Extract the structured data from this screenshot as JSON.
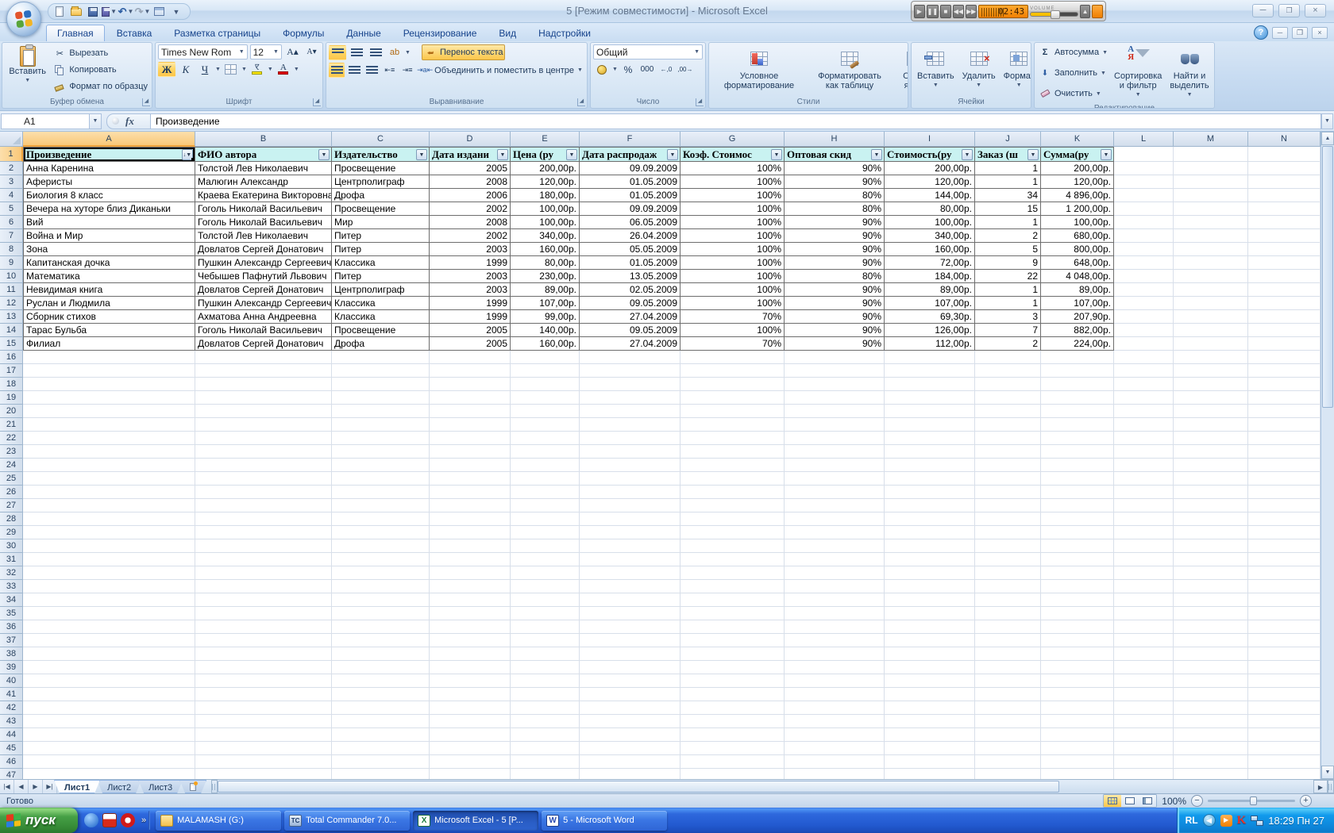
{
  "titlebar": {
    "title": "5  [Режим совместимости] - Microsoft Excel",
    "player": {
      "time": "02:43",
      "volume_label": "VOLUME"
    },
    "qat_icons": [
      "new-document",
      "open-folder",
      "save",
      "save-as",
      "undo",
      "redo",
      "print-preview",
      "customize-qat"
    ]
  },
  "ribbon": {
    "tabs": [
      {
        "label": "Главная",
        "active": true
      },
      {
        "label": "Вставка",
        "active": false
      },
      {
        "label": "Разметка страницы",
        "active": false
      },
      {
        "label": "Формулы",
        "active": false
      },
      {
        "label": "Данные",
        "active": false
      },
      {
        "label": "Рецензирование",
        "active": false
      },
      {
        "label": "Вид",
        "active": false
      },
      {
        "label": "Надстройки",
        "active": false
      }
    ],
    "clipboard": {
      "title": "Буфер обмена",
      "paste": "Вставить",
      "cut": "Вырезать",
      "copy": "Копировать",
      "format_painter": "Формат по образцу"
    },
    "font": {
      "title": "Шрифт",
      "font_name": "Times New Rom",
      "font_size": "12",
      "bold": "Ж",
      "italic": "К",
      "underline": "Ч"
    },
    "alignment": {
      "title": "Выравнивание",
      "wrap_text": "Перенос текста",
      "merge_center": "Объединить и поместить в центре"
    },
    "number": {
      "title": "Число",
      "format": "Общий",
      "percent": "%",
      "thousands": "000"
    },
    "styles": {
      "title": "Стили",
      "conditional": "Условное форматирование",
      "format_table": "Форматировать как таблицу",
      "cell_styles": "Стили ячеек"
    },
    "cells": {
      "title": "Ячейки",
      "insert": "Вставить",
      "delete": "Удалить",
      "format": "Формат"
    },
    "editing": {
      "title": "Редактирование",
      "autosum": "Автосумма",
      "fill": "Заполнить",
      "clear": "Очистить",
      "sort_filter": "Сортировка и фильтр",
      "find_select": "Найти и выделить"
    }
  },
  "formula_bar": {
    "name_box": "A1",
    "content": "Произведение"
  },
  "sheet": {
    "selected_cell": "A1",
    "columns": [
      "A",
      "B",
      "C",
      "D",
      "E",
      "F",
      "G",
      "H",
      "I",
      "J",
      "K",
      "L",
      "M",
      "N"
    ],
    "total_rows": 47,
    "header_row": [
      "Произведение",
      "ФИО автора",
      "Издательство",
      "Дата издани",
      "Цена (ру",
      "Дата распродаж",
      "Коэф. Стоимос",
      "Оптовая скид",
      "Стоимость(ру",
      "Заказ (ш",
      "Сумма(ру"
    ],
    "sorted_column": "A",
    "rows": [
      [
        "Анна Каренина",
        "Толстой Лев Николаевич",
        "Просвещение",
        "2005",
        "200,00р.",
        "09.09.2009",
        "100%",
        "90%",
        "200,00р.",
        "1",
        "200,00р."
      ],
      [
        "Аферисты",
        "Малюгин Александр",
        "Центрполиграф",
        "2008",
        "120,00р.",
        "01.05.2009",
        "100%",
        "90%",
        "120,00р.",
        "1",
        "120,00р."
      ],
      [
        "Биология 8 класс",
        "Краева Екатерина Викторовна",
        "Дрофа",
        "2006",
        "180,00р.",
        "01.05.2009",
        "100%",
        "80%",
        "144,00р.",
        "34",
        "4 896,00р."
      ],
      [
        "Вечера на хуторе близ Диканьки",
        "Гоголь Николай Васильевич",
        "Просвещение",
        "2002",
        "100,00р.",
        "09.09.2009",
        "100%",
        "80%",
        "80,00р.",
        "15",
        "1 200,00р."
      ],
      [
        "Вий",
        "Гоголь Николай Васильевич",
        "Мир",
        "2008",
        "100,00р.",
        "06.05.2009",
        "100%",
        "90%",
        "100,00р.",
        "1",
        "100,00р."
      ],
      [
        "Война и Мир",
        "Толстой Лев Николаевич",
        "Питер",
        "2002",
        "340,00р.",
        "26.04.2009",
        "100%",
        "90%",
        "340,00р.",
        "2",
        "680,00р."
      ],
      [
        "Зона",
        "Довлатов Сергей Донатович",
        "Питер",
        "2003",
        "160,00р.",
        "05.05.2009",
        "100%",
        "90%",
        "160,00р.",
        "5",
        "800,00р."
      ],
      [
        "Капитанская дочка",
        "Пушкин Александр Сергеевич",
        "Классика",
        "1999",
        "80,00р.",
        "01.05.2009",
        "100%",
        "90%",
        "72,00р.",
        "9",
        "648,00р."
      ],
      [
        "Математика",
        "Чебышев Пафнутий Львович",
        "Питер",
        "2003",
        "230,00р.",
        "13.05.2009",
        "100%",
        "80%",
        "184,00р.",
        "22",
        "4 048,00р."
      ],
      [
        "Невидимая книга",
        "Довлатов Сергей Донатович",
        "Центрполиграф",
        "2003",
        "89,00р.",
        "02.05.2009",
        "100%",
        "90%",
        "89,00р.",
        "1",
        "89,00р."
      ],
      [
        "Руслан и Людмила",
        "Пушкин Александр Сергеевич",
        "Классика",
        "1999",
        "107,00р.",
        "09.05.2009",
        "100%",
        "90%",
        "107,00р.",
        "1",
        "107,00р."
      ],
      [
        "Сборник стихов",
        "Ахматова Анна Андреевна",
        "Классика",
        "1999",
        "99,00р.",
        "27.04.2009",
        "70%",
        "90%",
        "69,30р.",
        "3",
        "207,90р."
      ],
      [
        "Тарас Бульба",
        "Гоголь Николай Васильевич",
        "Просвещение",
        "2005",
        "140,00р.",
        "09.05.2009",
        "100%",
        "90%",
        "126,00р.",
        "7",
        "882,00р."
      ],
      [
        "Филиал",
        "Довлатов Сергей Донатович",
        "Дрофа",
        "2005",
        "160,00р.",
        "27.04.2009",
        "70%",
        "90%",
        "112,00р.",
        "2",
        "224,00р."
      ]
    ]
  },
  "sheet_tabs": {
    "tabs": [
      "Лист1",
      "Лист2",
      "Лист3"
    ],
    "active": "Лист1"
  },
  "status_bar": {
    "mode": "Готово",
    "zoom": "100%"
  },
  "taskbar": {
    "start_label": "пуск",
    "quick_launch_icons": [
      "browser-icon",
      "floppy-icon",
      "opera-icon"
    ],
    "buttons": [
      {
        "icon": "folder",
        "label": "MALAMASH (G:)",
        "active": false
      },
      {
        "icon": "total-commander",
        "label": "Total Commander 7.0...",
        "active": false
      },
      {
        "icon": "excel",
        "label": "Microsoft Excel - 5  [P...",
        "active": true
      },
      {
        "icon": "word",
        "label": "5 - Microsoft Word",
        "active": false
      }
    ],
    "tray": {
      "language": "RL",
      "clock": "18:29 Пн 27"
    }
  }
}
